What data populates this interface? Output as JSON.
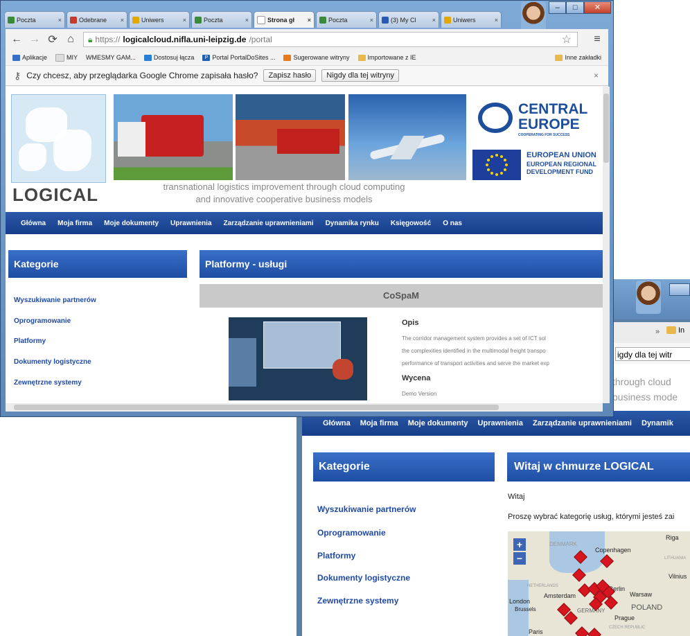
{
  "back_window": {
    "infobar_fragment": "igdy dla tej witr",
    "bookmark_fragment": "In",
    "header_fragment_1": "through cloud",
    "header_fragment_2": "business mode",
    "nav": [
      "Główna",
      "Moja firma",
      "Moje dokumenty",
      "Uprawnienia",
      "Zarządzanie uprawnieniami",
      "Dynamik"
    ],
    "kategorie_title": "Kategorie",
    "categories": [
      "Wyszukiwanie partnerów",
      "Oprogramowanie",
      "Platformy",
      "Dokumenty logistyczne",
      "Zewnętrzne systemy"
    ],
    "welcome_title": "Witaj w chmurze LOGICAL",
    "welcome_text": "Witaj",
    "prompt_text": "Proszę wybrać kategorię usług, którymi jesteś zai",
    "map": {
      "cities": [
        "Riga",
        "Copenhagen",
        "DENMARK",
        "Vilnius",
        "Amsterdam",
        "Berlin",
        "Warsaw",
        "London",
        "Brussels",
        "POLAND",
        "Prague",
        "Paris",
        "GERMANY",
        "NETHERLANDS",
        "LITHUANIA",
        "CZECH REPUBLIC"
      ],
      "zoom_in": "+",
      "zoom_out": "−"
    }
  },
  "front_window": {
    "tabs": [
      {
        "label": "Poczta",
        "color": "#3a8a3a"
      },
      {
        "label": "Odebrane",
        "color": "#c23b2b"
      },
      {
        "label": "Uniwers",
        "color": "#e0a800"
      },
      {
        "label": "Poczta",
        "color": "#3a8a3a"
      },
      {
        "label": "Strona gł",
        "color": "#ffffff",
        "active": true
      },
      {
        "label": "Poczta",
        "color": "#3a8a3a"
      },
      {
        "label": "(3) My Cl",
        "color": "#2a5ab8"
      },
      {
        "label": "Uniwers",
        "color": "#e0a800"
      }
    ],
    "window_buttons": {
      "minimize": "–",
      "maximize": "□",
      "close": "✕"
    },
    "url": {
      "scheme": "https://",
      "host": "logicalcloud.nifla.uni-leipzig.de",
      "path": "/portal"
    },
    "bookmarks": [
      "Aplikacje",
      "MIY",
      "WMESMY GAM...",
      "Dostosuj łącza",
      "Portal PortalDoSites ...",
      "Sugerowane witryny",
      "Importowane z IE"
    ],
    "bookmarks_other": "Inne zakładki",
    "infobar": {
      "question": "Czy chcesz, aby przeglądarka Google Chrome zapisała hasło?",
      "save_button": "Zapisz hasło",
      "never_button": "Nigdy dla tej witryny",
      "close": "×"
    },
    "header": {
      "logo_text": "LOGICAL",
      "tagline_1": "transnational logistics improvement through cloud computing",
      "tagline_2": "and innovative cooperative business models",
      "partner_1": "CENTRAL",
      "partner_2": "EUROPE",
      "partner_sub": "COOPERATING FOR SUCCESS",
      "eu_1": "EUROPEAN UNION",
      "eu_2": "EUROPEAN REGIONAL",
      "eu_3": "DEVELOPMENT FUND"
    },
    "nav": [
      "Główna",
      "Moja firma",
      "Moje dokumenty",
      "Uprawnienia",
      "Zarządzanie uprawnieniami",
      "Dynamika rynku",
      "Księgowość",
      "O nas"
    ],
    "kategorie_title": "Kategorie",
    "categories": [
      "Wyszukiwanie partnerów",
      "Oprogramowanie",
      "Platformy",
      "Dokumenty logistyczne",
      "Zewnętrzne systemy"
    ],
    "platform_title": "Platformy - usługi",
    "service_name": "CoSpaM",
    "opis_label": "Opis",
    "opis_text": [
      "The corridor management system provides a set of ICT sol",
      "the complexities identified in the multimodal freight transpo",
      "performance of transport activities and serve the market exp"
    ],
    "wycena_label": "Wycena",
    "wycena_value": "Demo Version"
  }
}
